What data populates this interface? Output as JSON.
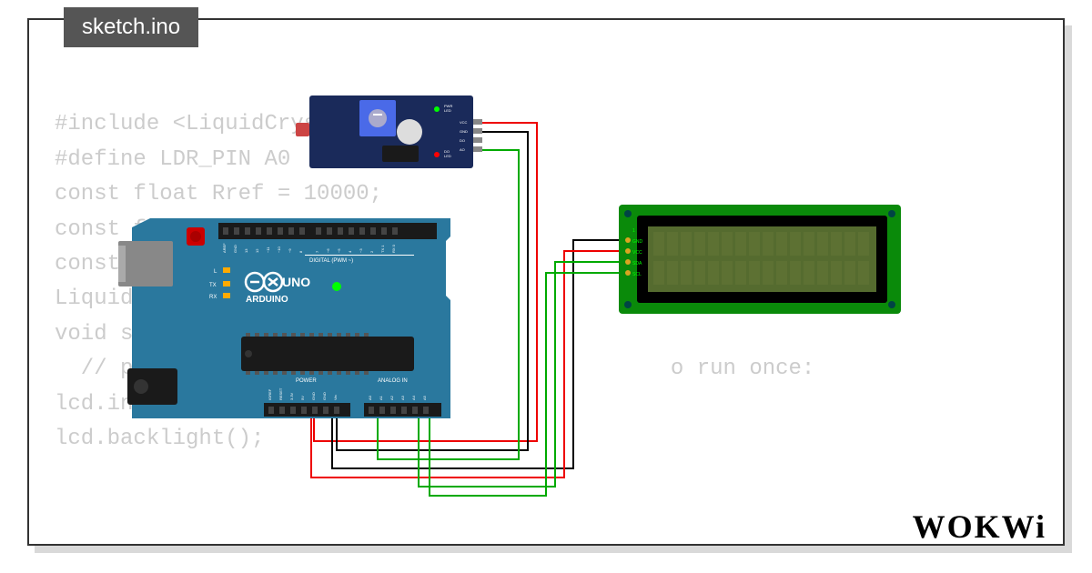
{
  "tab": {
    "filename": "sketch.ino"
  },
  "code": {
    "lines": [
      "#include <LiquidCrystal_I2C.h>",
      "#define LDR_PIN A0",
      "const float Rref = 10000;",
      "const float RL10 = 50;",
      "const float",
      "LiquidCrys",
      "void setup(",
      "  // put you                                   o run once:",
      "lcd.init();",
      "lcd.backlight();"
    ]
  },
  "logo": {
    "text": "WOKWi"
  },
  "arduino": {
    "brand": "ARDUINO",
    "model": "UNO",
    "digital_label": "DIGITAL (PWM ~)",
    "analog_label": "ANALOG IN",
    "power_label": "POWER",
    "tx": "TX",
    "rx": "RX",
    "l": "L",
    "top_pins": [
      "AREF",
      "GND",
      "13",
      "12",
      "~11",
      "~10",
      "~9",
      "8",
      "7",
      "~6",
      "~5",
      "4",
      "~3",
      "2",
      "TX 1",
      "RX 0"
    ],
    "bottom_pins_left": [
      "IOREF",
      "RESET",
      "3.3V",
      "5V",
      "GND",
      "GND",
      "Vin"
    ],
    "bottom_pins_right": [
      "A0",
      "A1",
      "A2",
      "A3",
      "A4",
      "A5"
    ]
  },
  "lcd": {
    "pins": [
      "GND",
      "VCC",
      "SDA",
      "SCL"
    ]
  },
  "ldr_module": {
    "labels_right": [
      "VCC",
      "GND",
      "DO",
      "AO"
    ],
    "pwr_led": "PWR\nLED",
    "do_led": "DO\nLED"
  }
}
